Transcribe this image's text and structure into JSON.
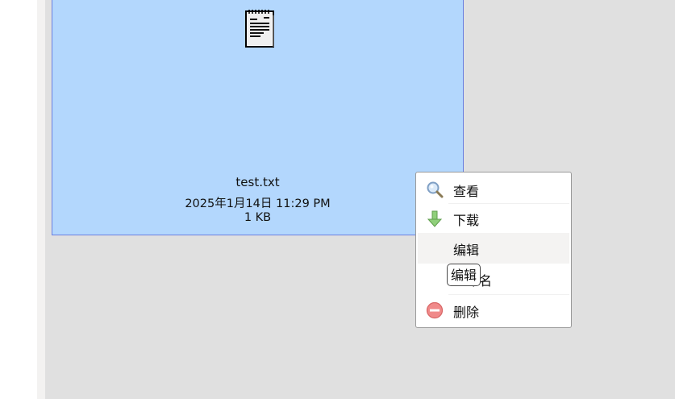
{
  "file": {
    "name": "test.txt",
    "modified": "2025年1月14日 11:29 PM",
    "size": "1 KB",
    "icon": "notepad-icon"
  },
  "context_menu": {
    "items": [
      {
        "label": "查看",
        "icon": "magnifier-icon"
      },
      {
        "label": "下载",
        "icon": "download-arrow-icon"
      },
      {
        "label": "编辑",
        "icon": ""
      },
      {
        "label": "重命名",
        "icon": ""
      },
      {
        "label": "删除",
        "icon": "delete-icon"
      }
    ]
  },
  "tooltip": {
    "text": "编辑"
  },
  "colors": {
    "tile_background": "#b3d7fd",
    "tile_border": "#6a7fe0",
    "page_background": "#e0e0e0",
    "menu_hover": "#f4f3f2"
  }
}
